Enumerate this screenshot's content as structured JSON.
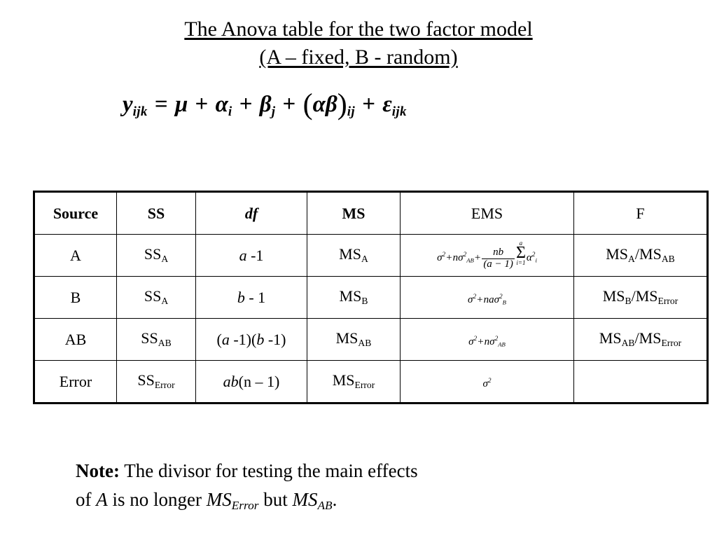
{
  "slide": {
    "title_line_1": "The Anova table for the two factor model",
    "title_line_2": "(A – fixed, B - random)"
  },
  "model_equation": {
    "lhs_var": "y",
    "lhs_sub": "ijk",
    "equals": "=",
    "mu": "μ",
    "alpha": "α",
    "alpha_sub": "i",
    "beta": "β",
    "beta_sub": "j",
    "interaction_open": "(",
    "interaction_alpha": "α",
    "interaction_beta": "β",
    "interaction_close": ")",
    "interaction_sub": "ij",
    "epsilon": "ε",
    "epsilon_sub": "ijk",
    "plus": "+",
    "plain_text": "y_ijk = μ + α_i + β_j + (αβ)_ij + ε_ijk"
  },
  "table": {
    "headers": [
      {
        "label": "Source",
        "style": "bold"
      },
      {
        "label": "SS",
        "style": "bold"
      },
      {
        "label": "df",
        "style": "bold-italic"
      },
      {
        "label": "MS",
        "style": "bold"
      },
      {
        "label": "EMS",
        "style": "plain"
      },
      {
        "label": "F",
        "style": "plain"
      }
    ],
    "rows": [
      {
        "source": "A",
        "ss_base": "SS",
        "ss_sub": "A",
        "df_text": "a -1",
        "ms_base": "MS",
        "ms_sub": "A",
        "ems_text": "σ² + nσ²_AB + nb/(a−1) Σ(i=1..a) α²_i",
        "f_num_base": "MS",
        "f_num_sub": "A",
        "f_den_base": "MS",
        "f_den_sub": "AB",
        "f_text": "MS_A/MS_AB"
      },
      {
        "source": "B",
        "ss_base": "SS",
        "ss_sub": "A",
        "df_text": "b - 1",
        "ms_base": "MS",
        "ms_sub": "B",
        "ems_text": "σ² + naσ²_B",
        "f_num_base": "MS",
        "f_num_sub": "B",
        "f_den_base": "MS",
        "f_den_sub": "Error",
        "f_text": "MS_B/MS_Error"
      },
      {
        "source": "AB",
        "ss_base": "SS",
        "ss_sub": "AB",
        "df_text": "(a -1)(b -1)",
        "ms_base": "MS",
        "ms_sub": "AB",
        "ems_text": "σ² + nσ²_AB",
        "f_num_base": "MS",
        "f_num_sub": "AB",
        "f_den_base": "MS",
        "f_den_sub": "Error",
        "f_text": "MS_AB/MS_Error"
      },
      {
        "source": "Error",
        "ss_base": "SS",
        "ss_sub": "Error",
        "df_text": "ab(n – 1)",
        "ms_base": "MS",
        "ms_sub": "Error",
        "ems_text": "σ²",
        "f_num_base": "",
        "f_num_sub": "",
        "f_den_base": "",
        "f_den_sub": "",
        "f_text": ""
      }
    ],
    "math_symbols": {
      "sigma": "σ",
      "alpha": "α",
      "sum": "Σ",
      "square": "2",
      "n": "n",
      "nb": "nb",
      "na": "na",
      "a_minus_1": "(a − 1)",
      "sum_lower": "i=1",
      "sum_upper": "a",
      "sub_AB": "AB",
      "sub_B": "B",
      "sub_i": "i"
    },
    "df_parts": {
      "a_ital": "a",
      "b_ital": "b",
      "ab_ital": "ab",
      "n_ital": "n",
      "a_minus_one_tail": " -1",
      "b_minus_one_tail": " - 1",
      "paren_open": "(",
      "paren_close": ")",
      "ab_n_minus_one": "(n – 1)"
    }
  },
  "note": {
    "label": "Note:",
    "text_part_1": " The divisor for testing the main effects",
    "text_part_2": "of ",
    "italic_A": "A",
    "text_part_3": " is no longer ",
    "ms_error_base": "MS",
    "ms_error_sub": "Error",
    "text_part_4": " but ",
    "ms_ab_base": "MS",
    "ms_ab_sub": "AB",
    "period": ".",
    "full_text": "Note: The divisor for testing the main effects of A is no longer MS_Error but MS_AB."
  }
}
